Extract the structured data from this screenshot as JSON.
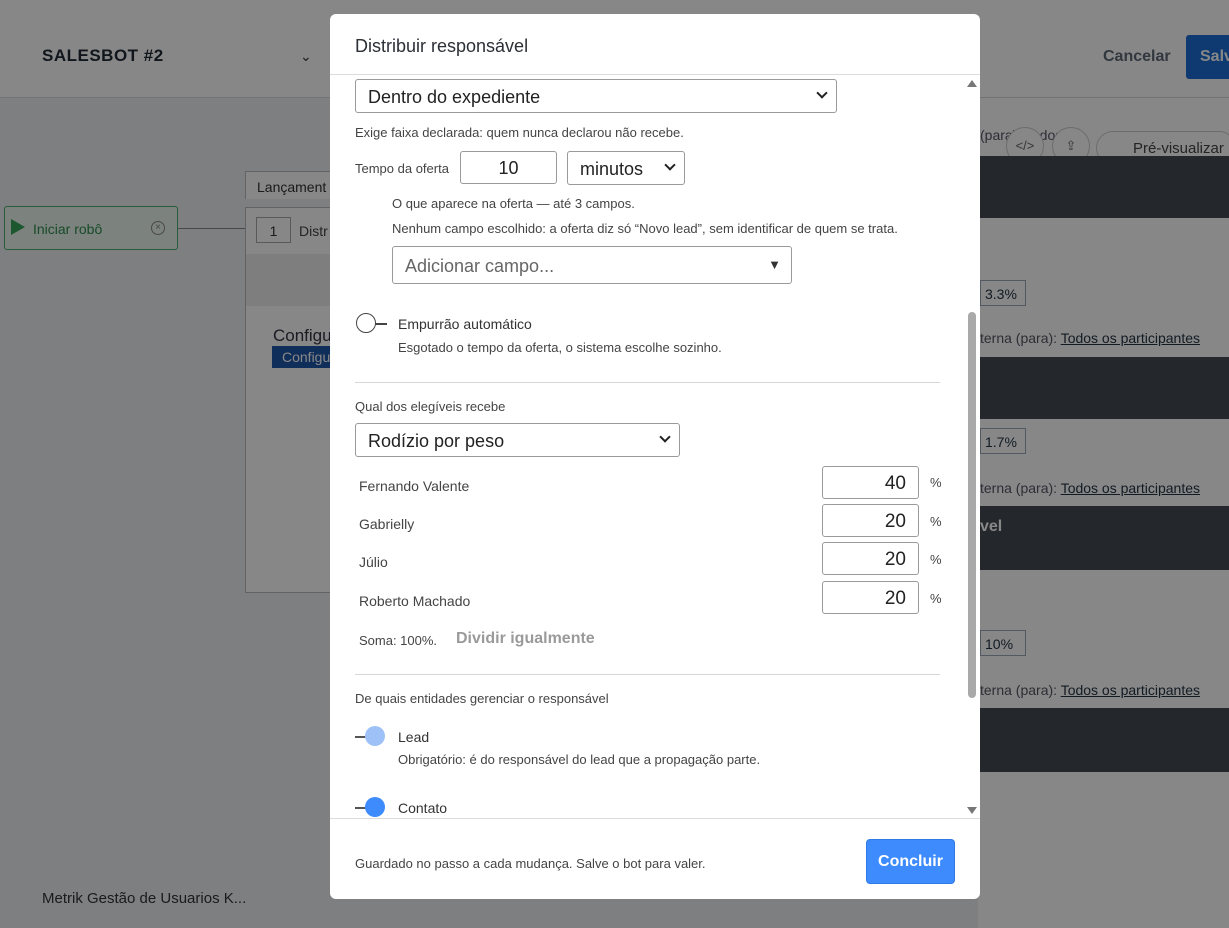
{
  "background": {
    "bot_title": "SALESBOT #2",
    "cancel_label": "Cancelar",
    "save_label": "Salv",
    "start_node_label": "Iniciar robô",
    "step_tab_label": "Lançament",
    "step_number": "1",
    "step_name": "Distr",
    "config_text": "Configu",
    "config_button": "Configu",
    "preview_label": "Pré-visualizar",
    "pills": [
      "3.3%",
      "1.7%",
      "10%"
    ],
    "interna_label": "terna (para):",
    "all_participants": "Todos os participantes",
    "partial_text": "vel",
    "top_partial": "(para): Todos os",
    "bottom_item": "Metrik Gestão de Usuarios K..."
  },
  "modal": {
    "title": "Distribuir responsável",
    "schedule_select": "Dentro do expediente",
    "schedule_note": "Exige faixa declarada: quem nunca declarou não recebe.",
    "offer_time_label": "Tempo da oferta",
    "offer_time_value": "10",
    "offer_unit": "minutos",
    "offer_fields_title": "O que aparece na oferta — até 3 campos.",
    "offer_fields_note": "Nenhum campo escolhido: a oferta diz só “Novo lead”, sem identificar de quem se trata.",
    "add_field_placeholder": "Adicionar campo...",
    "auto_push_label": "Empurrão automático",
    "auto_push_note": "Esgotado o tempo da oferta, o sistema escolhe sozinho.",
    "who_receives_title": "Qual dos elegíveis recebe",
    "rotation_select": "Rodízio por peso",
    "weights": [
      {
        "name": "Fernando Valente",
        "value": "40",
        "unit": "%"
      },
      {
        "name": "Gabrielly",
        "value": "20",
        "unit": "%"
      },
      {
        "name": "Júlio",
        "value": "20",
        "unit": "%"
      },
      {
        "name": "Roberto Machado",
        "value": "20",
        "unit": "%"
      }
    ],
    "sum_text": "Soma: 100%.",
    "split_equally": "Dividir igualmente",
    "entities_title": "De quais entidades gerenciar o responsável",
    "lead_label": "Lead",
    "lead_note": "Obrigatório: é do responsável do lead que a propagação parte.",
    "contact_label": "Contato",
    "footer_note": "Guardado no passo a cada mudança. Salve o bot para valer.",
    "done_button": "Concluir"
  },
  "colors": {
    "primary": "#3d8bfd",
    "lead_toggle": "#9ec2f8",
    "contact_toggle": "#3d8bfd",
    "start_green": "#35a55a"
  }
}
